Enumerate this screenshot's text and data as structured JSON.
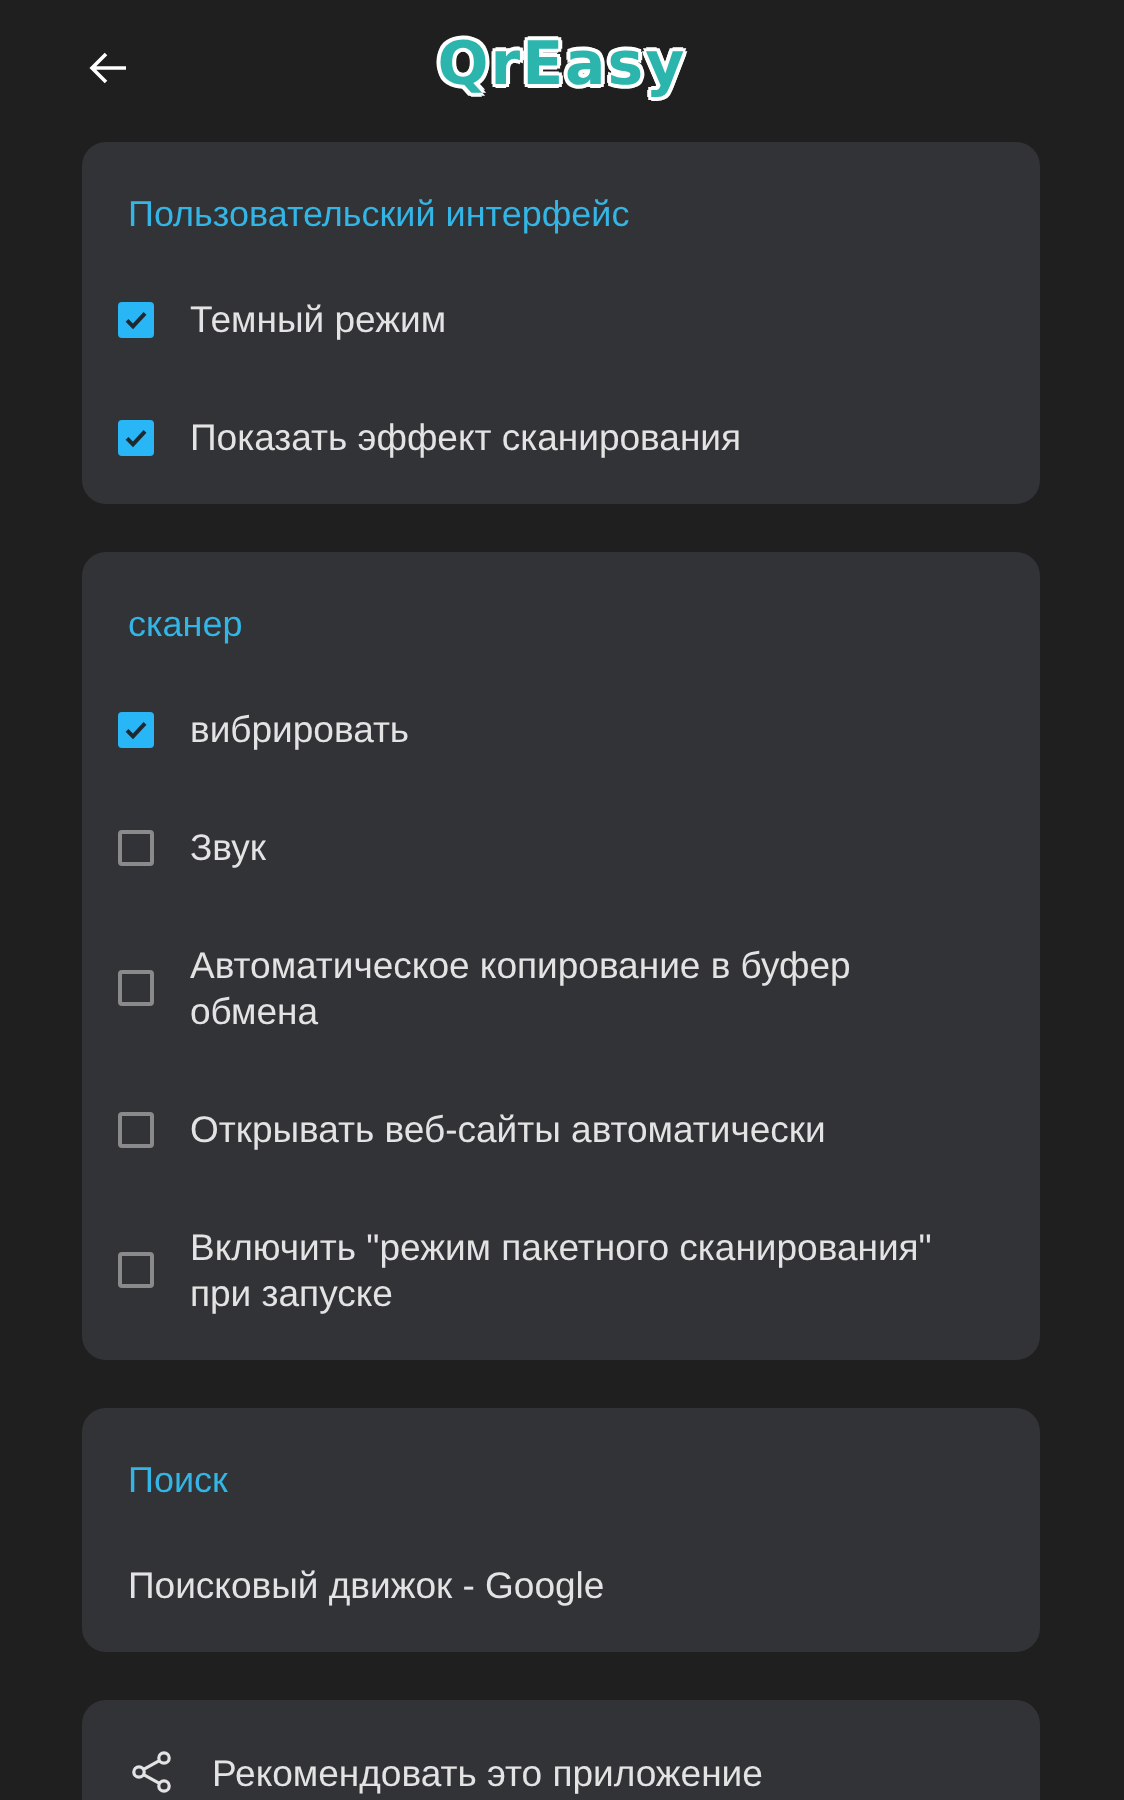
{
  "app_bar": {
    "logo": "QrEasy"
  },
  "sections": [
    {
      "title": "Пользовательский интерфейс",
      "items": [
        {
          "kind": "checkbox",
          "label": "Темный режим",
          "checked": true
        },
        {
          "kind": "checkbox",
          "label": "Показать эффект сканирования",
          "checked": true
        }
      ]
    },
    {
      "title": "сканер",
      "items": [
        {
          "kind": "checkbox",
          "label": "вибрировать",
          "checked": true
        },
        {
          "kind": "checkbox",
          "label": "Звук",
          "checked": false
        },
        {
          "kind": "checkbox",
          "label": "Автоматическое копирование в буфер обмена",
          "checked": false
        },
        {
          "kind": "checkbox",
          "label": "Открывать веб-сайты автоматически",
          "checked": false
        },
        {
          "kind": "checkbox",
          "label": "Включить \"режим пакетного сканирования\" при запуске",
          "checked": false
        }
      ]
    },
    {
      "title": "Поиск",
      "items": [
        {
          "kind": "text",
          "label": "Поисковый движок - Google"
        }
      ]
    },
    {
      "items": [
        {
          "kind": "share",
          "label": "Рекомендовать это приложение"
        }
      ]
    }
  ]
}
